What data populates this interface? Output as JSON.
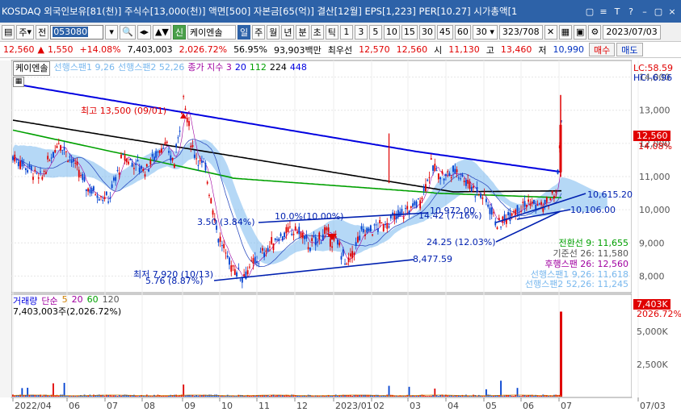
{
  "window": {
    "title": "KOSDAQ 외국인보유[81(천)] 주식수[13,000(천)] 액면[500] 자본금[65(억)] 결산[12월] EPS[1,223] PER[10.27] 시가총액[1",
    "controls": [
      "▢",
      "≡",
      "T",
      "?",
      "–",
      "▢",
      "×"
    ]
  },
  "toolbar": {
    "period_selector": "주",
    "total_label": "전",
    "stock_code": "053080",
    "stock_name": "케이엔솔",
    "new_label": "신",
    "period_buttons": [
      "일",
      "주",
      "월",
      "년",
      "분",
      "초",
      "틱"
    ],
    "intervals": [
      "1",
      "3",
      "5",
      "10",
      "15",
      "30",
      "45",
      "60"
    ],
    "interval_value": "30",
    "counter": "323",
    "counter_total": "/708",
    "date": "2023/07/03"
  },
  "quote": {
    "price": "12,560",
    "arrow": "▲",
    "change": "1,550",
    "change_pct": "+14.08%",
    "volume": "7,403,003",
    "volume_pct": "2,026.72%",
    "ratio": "56.95%",
    "amount": "93,903백만",
    "best_ask_label": "최우선",
    "best_ask": "12,570",
    "best_bid": "12,560",
    "open_label": "시",
    "open": "11,130",
    "high_label": "고",
    "high": "13,460",
    "low_label": "저",
    "low": "10,990",
    "buy_label": "매수",
    "sell_label": "매도"
  },
  "legend": {
    "name": "케이엔솔",
    "span1": "선행스팬1 9,26",
    "span2": "선행스팬2 52,26",
    "close_ma": "종가 지수 3",
    "ma20": "20",
    "ma112": "112",
    "ma224": "224",
    "ma448": "448",
    "lc": "LC:58.59",
    "hc": "HC:-6.96"
  },
  "annotations": {
    "high_label": "최고 13,500 (09/01)",
    "low_label": "최저 7,920 (10/13)",
    "low_pct": "5.76 (8.87%)",
    "pct_384": "3.50 (3.84%)",
    "pct_middle": "10.0%(10.00%)",
    "val_10972": "10,972.00",
    "val_1442": "14.42 (7.16%)",
    "val_2425": "24.25 (12.03%)",
    "val_8477": "8,477.59",
    "val_10615": "10,615.20",
    "val_10106": "10,106.00"
  },
  "ichimoku_info": {
    "conversion": "전환선 9: 11,655",
    "base": "기준선 26: 11,580",
    "lagging": "후행스팬 26: 12,560",
    "span1": "선행스팬1 9,26: 11,618",
    "span2": "선행스팬2 52,26: 11,245"
  },
  "price_axis": {
    "ticks": [
      "14,000",
      "13,000",
      "12,000",
      "11,000",
      "10,000",
      "9,000",
      "8,000"
    ],
    "current": "12,560",
    "current_pct": "14.08%"
  },
  "volume_panel": {
    "legend_name": "거래량",
    "legend_simple": "단순",
    "ma5": "5",
    "ma20": "20",
    "ma60": "60",
    "ma120": "120",
    "info": "7,403,003주(2,026.72%)",
    "ticks": [
      "5,000K",
      "2,500K"
    ],
    "current": "7,403K",
    "current_pct": "2026.72%"
  },
  "date_axis": {
    "labels": [
      "2022/04",
      "06",
      "07",
      "08",
      "09",
      "10",
      "11",
      "12",
      "2023/01",
      "02",
      "03",
      "04",
      "05",
      "06",
      "07",
      "07/03"
    ]
  },
  "colors": {
    "title_bg": "#2d62a8",
    "candle_up": "#e00000",
    "candle_down": "#0040d0",
    "cloud": "#79b8ee",
    "ma_green": "#00a000",
    "ma_black": "#000000",
    "ma_blue": "#0000e0",
    "trend": "#0020b0"
  }
}
